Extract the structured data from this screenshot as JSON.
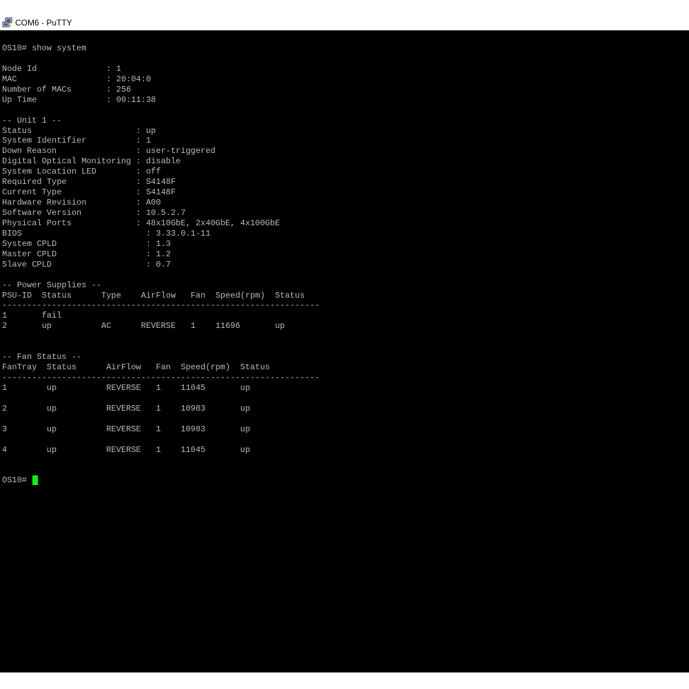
{
  "window": {
    "title": "COM6 - PuTTY",
    "icon": "putty-icon"
  },
  "terminal": {
    "lines": [
      "OS10# show system",
      "",
      "Node Id              : 1",
      "MAC                  : 20:04:0",
      "Number of MACs       : 256",
      "Up Time              : 00:11:38",
      "",
      "-- Unit 1 --",
      "Status                     : up",
      "System Identifier          : 1",
      "Down Reason                : user-triggered",
      "Digital Optical Monitoring : disable",
      "System Location LED        : off",
      "Required Type              : S4148F",
      "Current Type               : S4148F",
      "Hardware Revision          : A00",
      "Software Version           : 10.5.2.7",
      "Physical Ports             : 48x10GbE, 2x40GbE, 4x100GbE",
      "BIOS                         : 3.33.0.1-11",
      "System CPLD                  : 1.3",
      "Master CPLD                  : 1.2",
      "Slave CPLD                   : 0.7",
      "",
      "-- Power Supplies --",
      "PSU-ID  Status      Type    AirFlow   Fan  Speed(rpm)  Status",
      "----------------------------------------------------------------",
      "1       fail",
      "2       up          AC      REVERSE   1    11696       up",
      "",
      "",
      "-- Fan Status --",
      "FanTray  Status      AirFlow   Fan  Speed(rpm)  Status",
      "----------------------------------------------------------------",
      "1        up          REVERSE   1    11045       up",
      "",
      "2        up          REVERSE   1    10983       up",
      "",
      "3        up          REVERSE   1    10983       up",
      "",
      "4        up          REVERSE   1    11045       up",
      "",
      ""
    ],
    "prompt": "OS10# ",
    "colors": {
      "background": "#000000",
      "foreground": "#bbbbbb",
      "cursor": "#00ff00"
    }
  }
}
